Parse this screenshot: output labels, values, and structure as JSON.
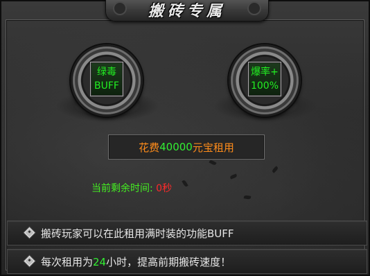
{
  "title": "搬砖专属",
  "buffs": [
    {
      "line1": "绿毒",
      "line2": "BUFF"
    },
    {
      "line1": "爆率+",
      "line2": "100%"
    }
  ],
  "cost": {
    "prefix": "花费",
    "amount": "40000",
    "currency": "元宝",
    "suffix": "租用"
  },
  "remaining": {
    "label": "当前剩余时间:",
    "value": "0秒"
  },
  "info": [
    {
      "text": "搬砖玩家可以在此租用满时装的功能BUFF"
    },
    {
      "before": "每次租用为",
      "highlight": "24",
      "after": "小时，提高前期搬砖速度！"
    }
  ],
  "colors": {
    "buff_text": "#22ee22",
    "cost_orange": "#ff8c1a",
    "cost_green": "#33ee33",
    "remaining_green": "#44ee22",
    "remaining_red": "#ff2a2a",
    "highlight_green": "#33ee33"
  }
}
